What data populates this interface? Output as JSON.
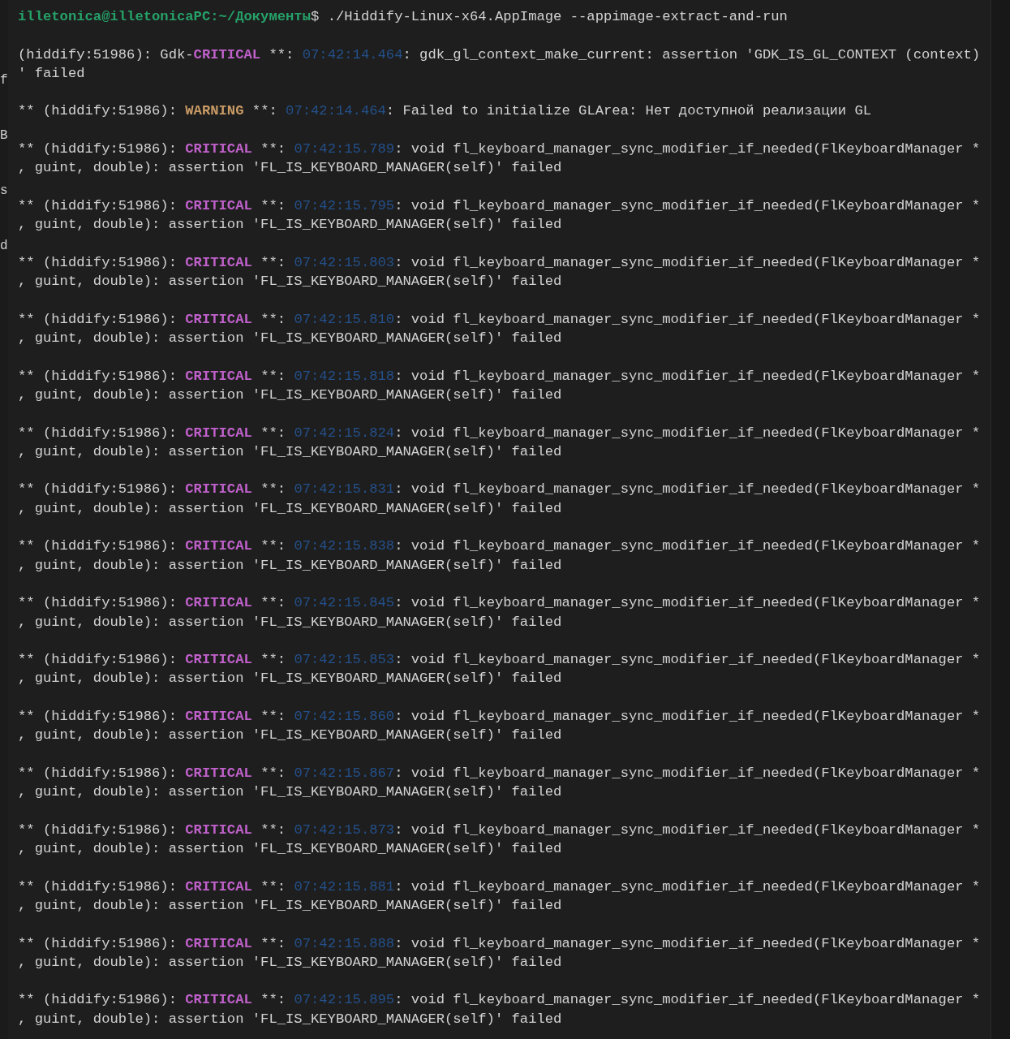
{
  "background_window": {
    "fragments": [
      "f",
      "B",
      "s",
      "d"
    ]
  },
  "terminal": {
    "prompt": {
      "location": "illetonica@illetonicaPC:~/Документы",
      "command": "$ ./Hiddify-Linux-x64.AppImage --appimage-extract-and-run"
    },
    "log": [
      {
        "kind": "critical",
        "prefix": "(hiddify:51986): Gdk-",
        "level": "CRITICAL",
        "separator": " **: ",
        "time": "07:42:14.464",
        "message": ": gdk_gl_context_make_current: assertion 'GDK_IS_GL_CONTEXT (context)",
        "continuation": "' failed"
      },
      {
        "kind": "warning",
        "prefix": "** (hiddify:51986): ",
        "level": "WARNING",
        "separator": " **: ",
        "time": "07:42:14.464",
        "message": ": Failed to initialize GLArea: Нет доступной реализации GL"
      },
      {
        "kind": "critical",
        "prefix": "** (hiddify:51986): ",
        "level": "CRITICAL",
        "separator": " **: ",
        "time": "07:42:15.789",
        "message": ": void fl_keyboard_manager_sync_modifier_if_needed(FlKeyboardManager *",
        "continuation": ", guint, double): assertion 'FL_IS_KEYBOARD_MANAGER(self)' failed"
      },
      {
        "kind": "critical",
        "prefix": "** (hiddify:51986): ",
        "level": "CRITICAL",
        "separator": " **: ",
        "time": "07:42:15.795",
        "message": ": void fl_keyboard_manager_sync_modifier_if_needed(FlKeyboardManager *",
        "continuation": ", guint, double): assertion 'FL_IS_KEYBOARD_MANAGER(self)' failed"
      },
      {
        "kind": "critical",
        "prefix": "** (hiddify:51986): ",
        "level": "CRITICAL",
        "separator": " **: ",
        "time": "07:42:15.803",
        "message": ": void fl_keyboard_manager_sync_modifier_if_needed(FlKeyboardManager *",
        "continuation": ", guint, double): assertion 'FL_IS_KEYBOARD_MANAGER(self)' failed"
      },
      {
        "kind": "critical",
        "prefix": "** (hiddify:51986): ",
        "level": "CRITICAL",
        "separator": " **: ",
        "time": "07:42:15.810",
        "message": ": void fl_keyboard_manager_sync_modifier_if_needed(FlKeyboardManager *",
        "continuation": ", guint, double): assertion 'FL_IS_KEYBOARD_MANAGER(self)' failed"
      },
      {
        "kind": "critical",
        "prefix": "** (hiddify:51986): ",
        "level": "CRITICAL",
        "separator": " **: ",
        "time": "07:42:15.818",
        "message": ": void fl_keyboard_manager_sync_modifier_if_needed(FlKeyboardManager *",
        "continuation": ", guint, double): assertion 'FL_IS_KEYBOARD_MANAGER(self)' failed"
      },
      {
        "kind": "critical",
        "prefix": "** (hiddify:51986): ",
        "level": "CRITICAL",
        "separator": " **: ",
        "time": "07:42:15.824",
        "message": ": void fl_keyboard_manager_sync_modifier_if_needed(FlKeyboardManager *",
        "continuation": ", guint, double): assertion 'FL_IS_KEYBOARD_MANAGER(self)' failed"
      },
      {
        "kind": "critical",
        "prefix": "** (hiddify:51986): ",
        "level": "CRITICAL",
        "separator": " **: ",
        "time": "07:42:15.831",
        "message": ": void fl_keyboard_manager_sync_modifier_if_needed(FlKeyboardManager *",
        "continuation": ", guint, double): assertion 'FL_IS_KEYBOARD_MANAGER(self)' failed"
      },
      {
        "kind": "critical",
        "prefix": "** (hiddify:51986): ",
        "level": "CRITICAL",
        "separator": " **: ",
        "time": "07:42:15.838",
        "message": ": void fl_keyboard_manager_sync_modifier_if_needed(FlKeyboardManager *",
        "continuation": ", guint, double): assertion 'FL_IS_KEYBOARD_MANAGER(self)' failed"
      },
      {
        "kind": "critical",
        "prefix": "** (hiddify:51986): ",
        "level": "CRITICAL",
        "separator": " **: ",
        "time": "07:42:15.845",
        "message": ": void fl_keyboard_manager_sync_modifier_if_needed(FlKeyboardManager *",
        "continuation": ", guint, double): assertion 'FL_IS_KEYBOARD_MANAGER(self)' failed"
      },
      {
        "kind": "critical",
        "prefix": "** (hiddify:51986): ",
        "level": "CRITICAL",
        "separator": " **: ",
        "time": "07:42:15.853",
        "message": ": void fl_keyboard_manager_sync_modifier_if_needed(FlKeyboardManager *",
        "continuation": ", guint, double): assertion 'FL_IS_KEYBOARD_MANAGER(self)' failed"
      },
      {
        "kind": "critical",
        "prefix": "** (hiddify:51986): ",
        "level": "CRITICAL",
        "separator": " **: ",
        "time": "07:42:15.860",
        "message": ": void fl_keyboard_manager_sync_modifier_if_needed(FlKeyboardManager *",
        "continuation": ", guint, double): assertion 'FL_IS_KEYBOARD_MANAGER(self)' failed"
      },
      {
        "kind": "critical",
        "prefix": "** (hiddify:51986): ",
        "level": "CRITICAL",
        "separator": " **: ",
        "time": "07:42:15.867",
        "message": ": void fl_keyboard_manager_sync_modifier_if_needed(FlKeyboardManager *",
        "continuation": ", guint, double): assertion 'FL_IS_KEYBOARD_MANAGER(self)' failed"
      },
      {
        "kind": "critical",
        "prefix": "** (hiddify:51986): ",
        "level": "CRITICAL",
        "separator": " **: ",
        "time": "07:42:15.873",
        "message": ": void fl_keyboard_manager_sync_modifier_if_needed(FlKeyboardManager *",
        "continuation": ", guint, double): assertion 'FL_IS_KEYBOARD_MANAGER(self)' failed"
      },
      {
        "kind": "critical",
        "prefix": "** (hiddify:51986): ",
        "level": "CRITICAL",
        "separator": " **: ",
        "time": "07:42:15.881",
        "message": ": void fl_keyboard_manager_sync_modifier_if_needed(FlKeyboardManager *",
        "continuation": ", guint, double): assertion 'FL_IS_KEYBOARD_MANAGER(self)' failed"
      },
      {
        "kind": "critical",
        "prefix": "** (hiddify:51986): ",
        "level": "CRITICAL",
        "separator": " **: ",
        "time": "07:42:15.888",
        "message": ": void fl_keyboard_manager_sync_modifier_if_needed(FlKeyboardManager *",
        "continuation": ", guint, double): assertion 'FL_IS_KEYBOARD_MANAGER(self)' failed"
      },
      {
        "kind": "critical",
        "prefix": "** (hiddify:51986): ",
        "level": "CRITICAL",
        "separator": " **: ",
        "time": "07:42:15.895",
        "message": ": void fl_keyboard_manager_sync_modifier_if_needed(FlKeyboardManager *",
        "continuation": ", guint, double): assertion 'FL_IS_KEYBOARD_MANAGER(self)' failed"
      }
    ]
  }
}
